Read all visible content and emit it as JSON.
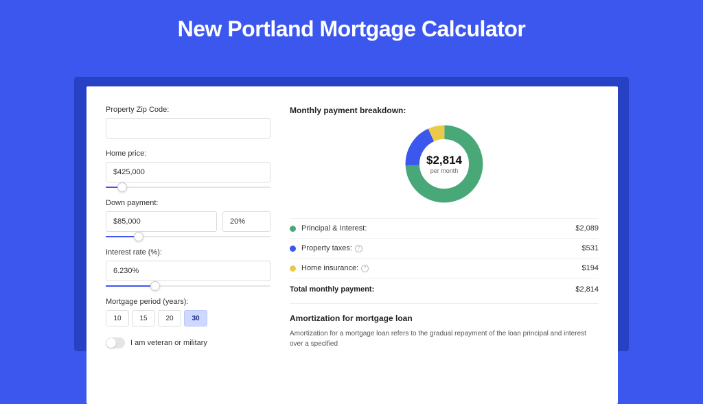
{
  "title": "New Portland Mortgage Calculator",
  "form": {
    "zip_label": "Property Zip Code:",
    "zip_value": "",
    "home_price_label": "Home price:",
    "home_price_value": "$425,000",
    "home_price_slider_pct": 10,
    "down_payment_label": "Down payment:",
    "down_payment_value": "$85,000",
    "down_payment_pct_value": "20%",
    "down_payment_slider_pct": 20,
    "interest_label": "Interest rate (%):",
    "interest_value": "6.230%",
    "interest_slider_pct": 30,
    "period_label": "Mortgage period (years):",
    "periods": [
      "10",
      "15",
      "20",
      "30"
    ],
    "period_selected": "30",
    "veteran_label": "I am veteran or military"
  },
  "breakdown": {
    "title": "Monthly payment breakdown:",
    "center_value": "$2,814",
    "center_sub": "per month",
    "items": [
      {
        "color": "green",
        "label": "Principal & Interest:",
        "info": false,
        "value": "$2,089"
      },
      {
        "color": "blue",
        "label": "Property taxes:",
        "info": true,
        "value": "$531"
      },
      {
        "color": "yellow",
        "label": "Home insurance:",
        "info": true,
        "value": "$194"
      }
    ],
    "total_label": "Total monthly payment:",
    "total_value": "$2,814"
  },
  "amort": {
    "title": "Amortization for mortgage loan",
    "body": "Amortization for a mortgage loan refers to the gradual repayment of the loan principal and interest over a specified"
  },
  "chart_data": {
    "type": "pie",
    "title": "Monthly payment breakdown",
    "series": [
      {
        "name": "Principal & Interest",
        "value": 2089,
        "color": "#48a878"
      },
      {
        "name": "Property taxes",
        "value": 531,
        "color": "#3b57ee"
      },
      {
        "name": "Home insurance",
        "value": 194,
        "color": "#eac94b"
      }
    ],
    "total": 2814
  }
}
